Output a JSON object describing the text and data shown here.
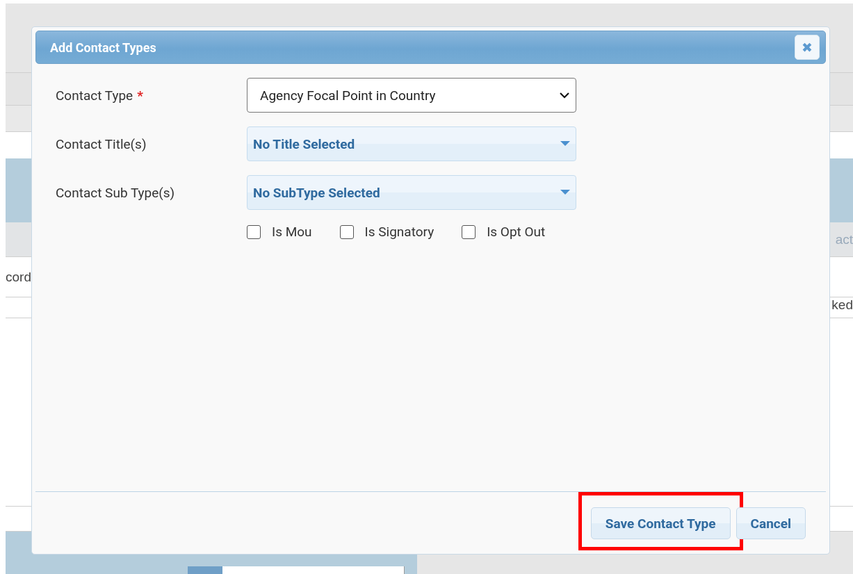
{
  "background": {
    "fragments": [
      {
        "kind": "header-cell",
        "text": "act"
      },
      {
        "kind": "row-left",
        "text": "cord"
      },
      {
        "kind": "row-right",
        "text": "ked"
      }
    ]
  },
  "dialog": {
    "title": "Add Contact Types",
    "close": "✖",
    "fields": [
      {
        "kind": "select",
        "label": "Contact Type",
        "required_mark": "*",
        "value": "Agency Focal Point in Country"
      },
      {
        "kind": "multiselect",
        "label": "Contact Title(s)",
        "value": "No Title Selected"
      },
      {
        "kind": "multiselect",
        "label": "Contact Sub Type(s)",
        "value": "No SubType Selected"
      }
    ],
    "checkboxes": [
      {
        "label": "Is Mou",
        "checked": false
      },
      {
        "label": "Is Signatory",
        "checked": false
      },
      {
        "label": "Is Opt Out",
        "checked": false
      }
    ],
    "buttons": [
      {
        "label": "Save Contact Type",
        "highlighted": true
      },
      {
        "label": "Cancel",
        "highlighted": false
      }
    ]
  }
}
